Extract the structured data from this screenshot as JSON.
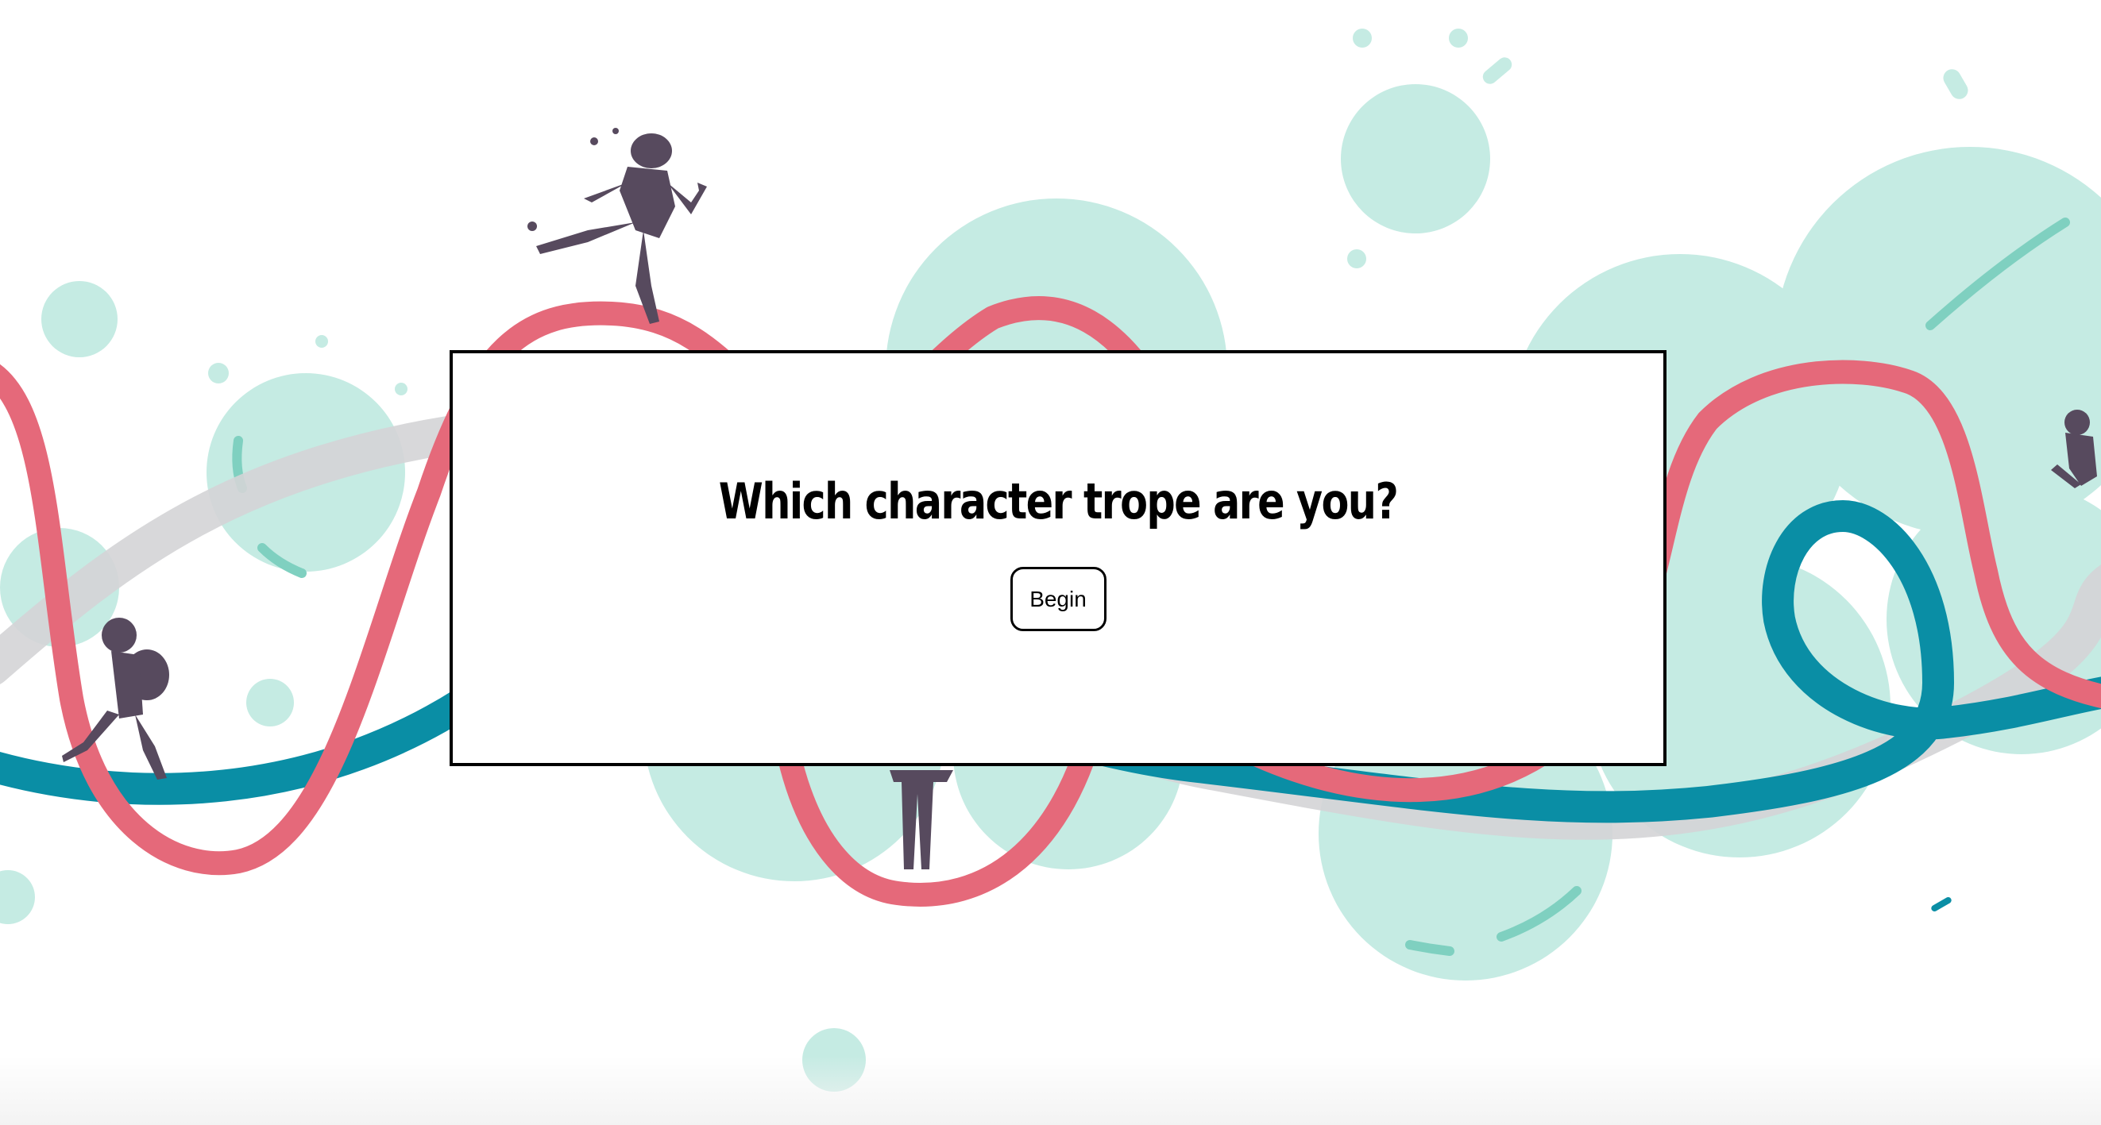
{
  "quiz": {
    "title": "Which character trope are you?",
    "begin_label": "Begin"
  },
  "colors": {
    "mint": "#c5ebe3",
    "mint_dark": "#7fd0c0",
    "ribbon_pink": "#e5697a",
    "ribbon_teal": "#0a8ea5",
    "ribbon_grey": "#d4d4d6",
    "figure": "#574a5e"
  },
  "background": {
    "figures": [
      "runner",
      "hiker-with-backpack",
      "standing-figure",
      "partial-figure-right"
    ]
  }
}
